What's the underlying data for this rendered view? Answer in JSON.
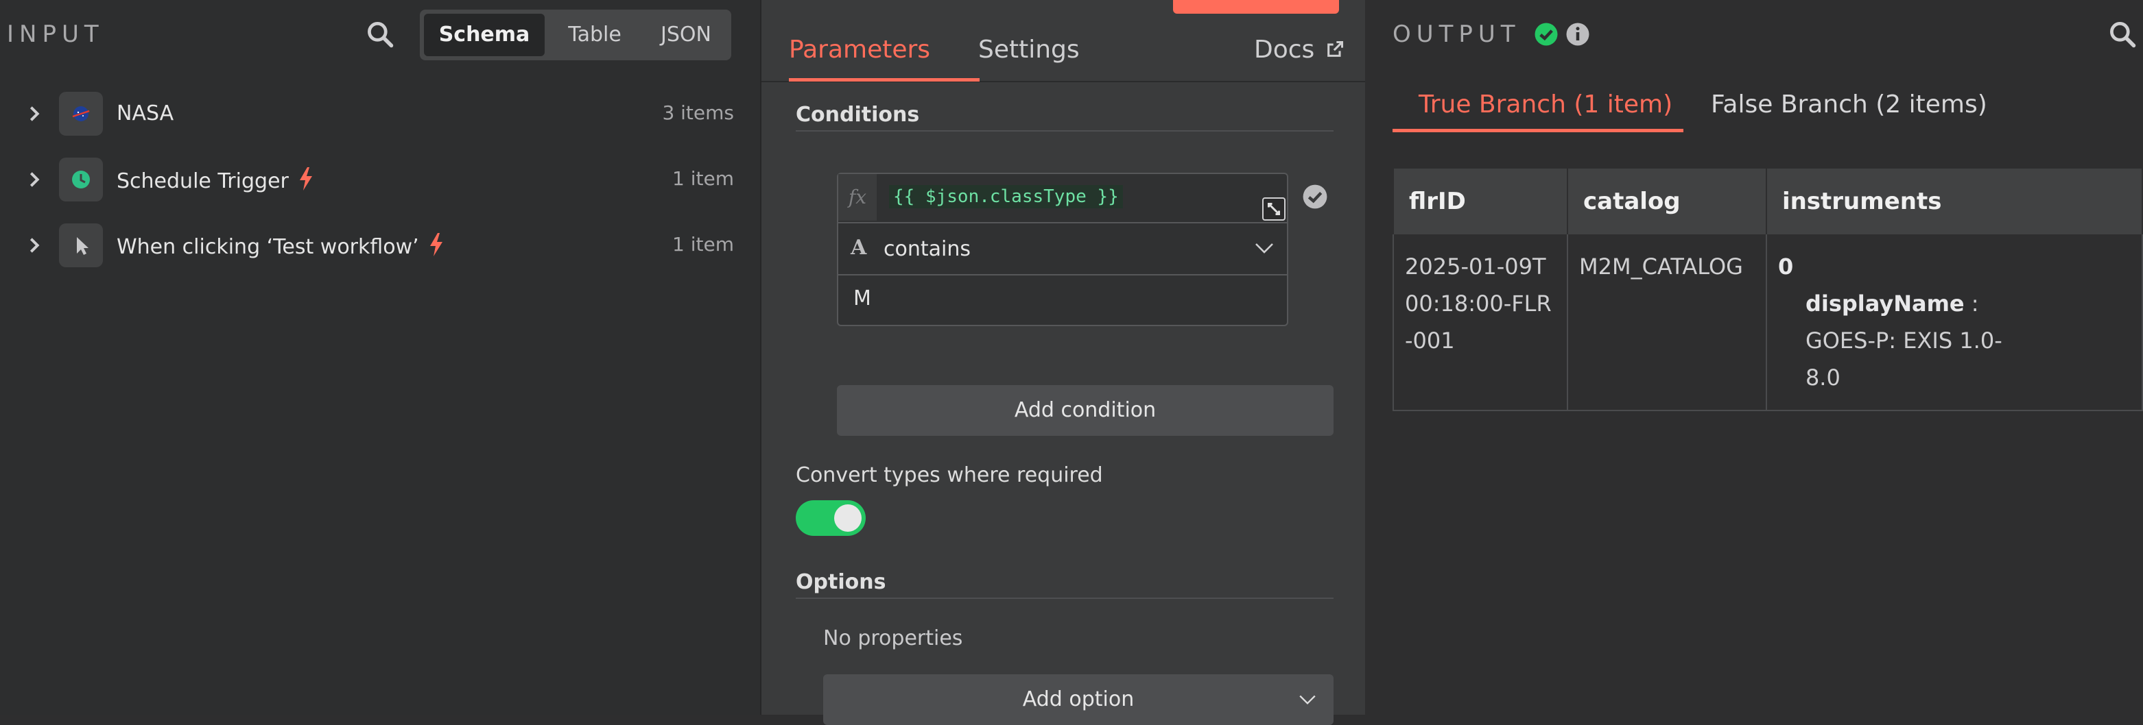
{
  "input": {
    "title": "INPUT",
    "view_tabs": [
      "Schema",
      "Table",
      "JSON"
    ],
    "active_view": "Schema",
    "nodes": [
      {
        "name": "NASA",
        "count": "3 items",
        "icon": "nasa-logo-icon",
        "trigger": false
      },
      {
        "name": "Schedule Trigger",
        "count": "1 item",
        "icon": "clock-icon",
        "trigger": true
      },
      {
        "name": "When clicking ‘Test workflow’",
        "count": "1 item",
        "icon": "cursor-icon",
        "trigger": true
      }
    ]
  },
  "node": {
    "tabs": {
      "parameters": "Parameters",
      "settings": "Settings",
      "docs": "Docs"
    },
    "conditions_title": "Conditions",
    "condition": {
      "fx_label": "fx",
      "left_value": "{{ $json.classType }}",
      "type_letter": "A",
      "operator": "contains",
      "right_value": "M"
    },
    "add_condition": "Add condition",
    "convert_types_label": "Convert types where required",
    "convert_types_enabled": true,
    "options_title": "Options",
    "no_properties": "No properties",
    "add_option": "Add option"
  },
  "output": {
    "title": "OUTPUT",
    "branch_tabs": {
      "true": "True Branch (1 item)",
      "false": "False Branch (2 items)"
    },
    "columns": [
      "flrID",
      "catalog",
      "instruments"
    ],
    "row": {
      "flrID": "2025-01-09T00:18:00-FLR-001",
      "catalog": "M2M_CATALOG",
      "instruments_index": "0",
      "instruments_key": "displayName",
      "instruments_sep": " : ",
      "instruments_value": "GOES-P: EXIS 1.0-8.0"
    }
  },
  "colors": {
    "accent": "#ff6d5a",
    "success": "#23c763",
    "code": "#6ee1a4"
  }
}
